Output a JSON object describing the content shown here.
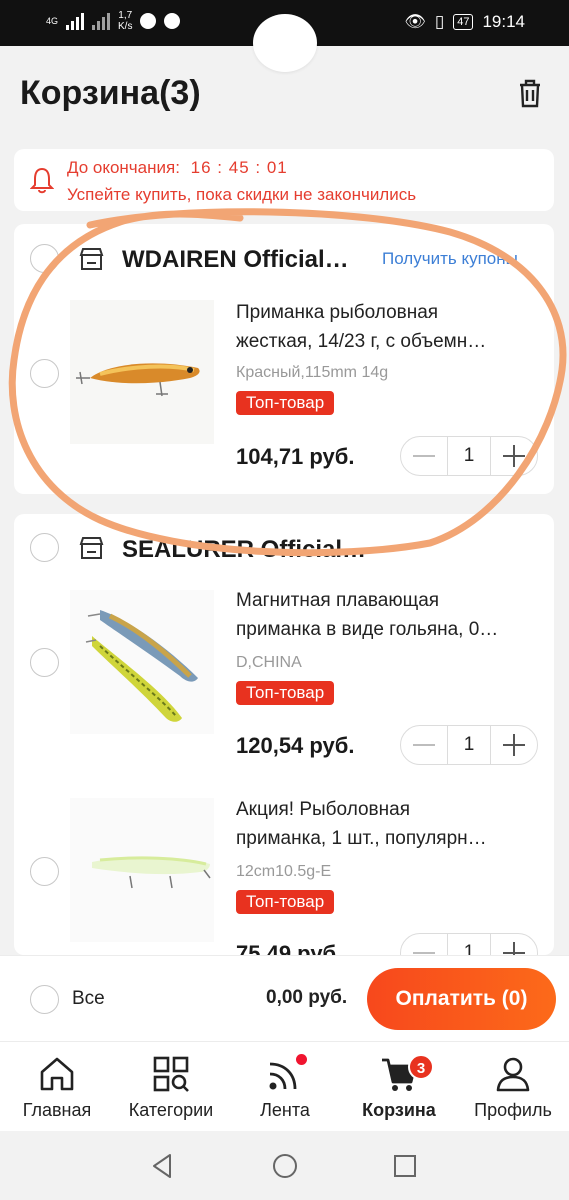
{
  "status_bar": {
    "network": "4G",
    "speed_value": "1,7",
    "speed_unit": "K/s",
    "battery": "47",
    "time": "19:14"
  },
  "header": {
    "title": "Корзина(3)",
    "trash_icon": "trash-icon"
  },
  "countdown": {
    "label": "До окончания:",
    "time": "16 : 45 : 01",
    "message": "Успейте купить, пока скидки не закончились"
  },
  "stores": [
    {
      "name": "WDAIREN Official…",
      "coupon_link": "Получить купоны",
      "items": [
        {
          "title_line1": "Приманка рыболовная",
          "title_line2": "жесткая, 14/23 г, с объемн…",
          "variant": "Красный,115mm 14g",
          "badge": "Топ-товар",
          "price": "104,71 руб.",
          "quantity": "1"
        }
      ]
    },
    {
      "name": "SEALURER Official…",
      "items": [
        {
          "title_line1": "Магнитная плавающая",
          "title_line2": "приманка в виде гольяна, 0…",
          "variant": "D,CHINA",
          "badge": "Топ-товар",
          "price": "120,54 руб.",
          "quantity": "1"
        },
        {
          "title_line1": "Акция! Рыболовная",
          "title_line2": "приманка, 1 шт., популярн…",
          "variant": "12cm10.5g-E",
          "badge": "Топ-товар",
          "price": "75,49 руб.",
          "quantity": "1"
        }
      ]
    }
  ],
  "checkout": {
    "select_all_label": "Все",
    "total": "0,00 руб.",
    "pay_button": "Оплатить (0)"
  },
  "tabs": [
    {
      "label": "Главная",
      "icon": "home-icon"
    },
    {
      "label": "Категории",
      "icon": "categories-icon"
    },
    {
      "label": "Лента",
      "icon": "feed-icon"
    },
    {
      "label": "Корзина",
      "icon": "cart-icon",
      "active": true,
      "badge": "3"
    },
    {
      "label": "Профиль",
      "icon": "profile-icon"
    }
  ],
  "colors": {
    "accent_red": "#e8321f",
    "link_blue": "#3d7fd6",
    "pay_orange": "#f7481c",
    "annotation_orange": "#f2a574"
  }
}
